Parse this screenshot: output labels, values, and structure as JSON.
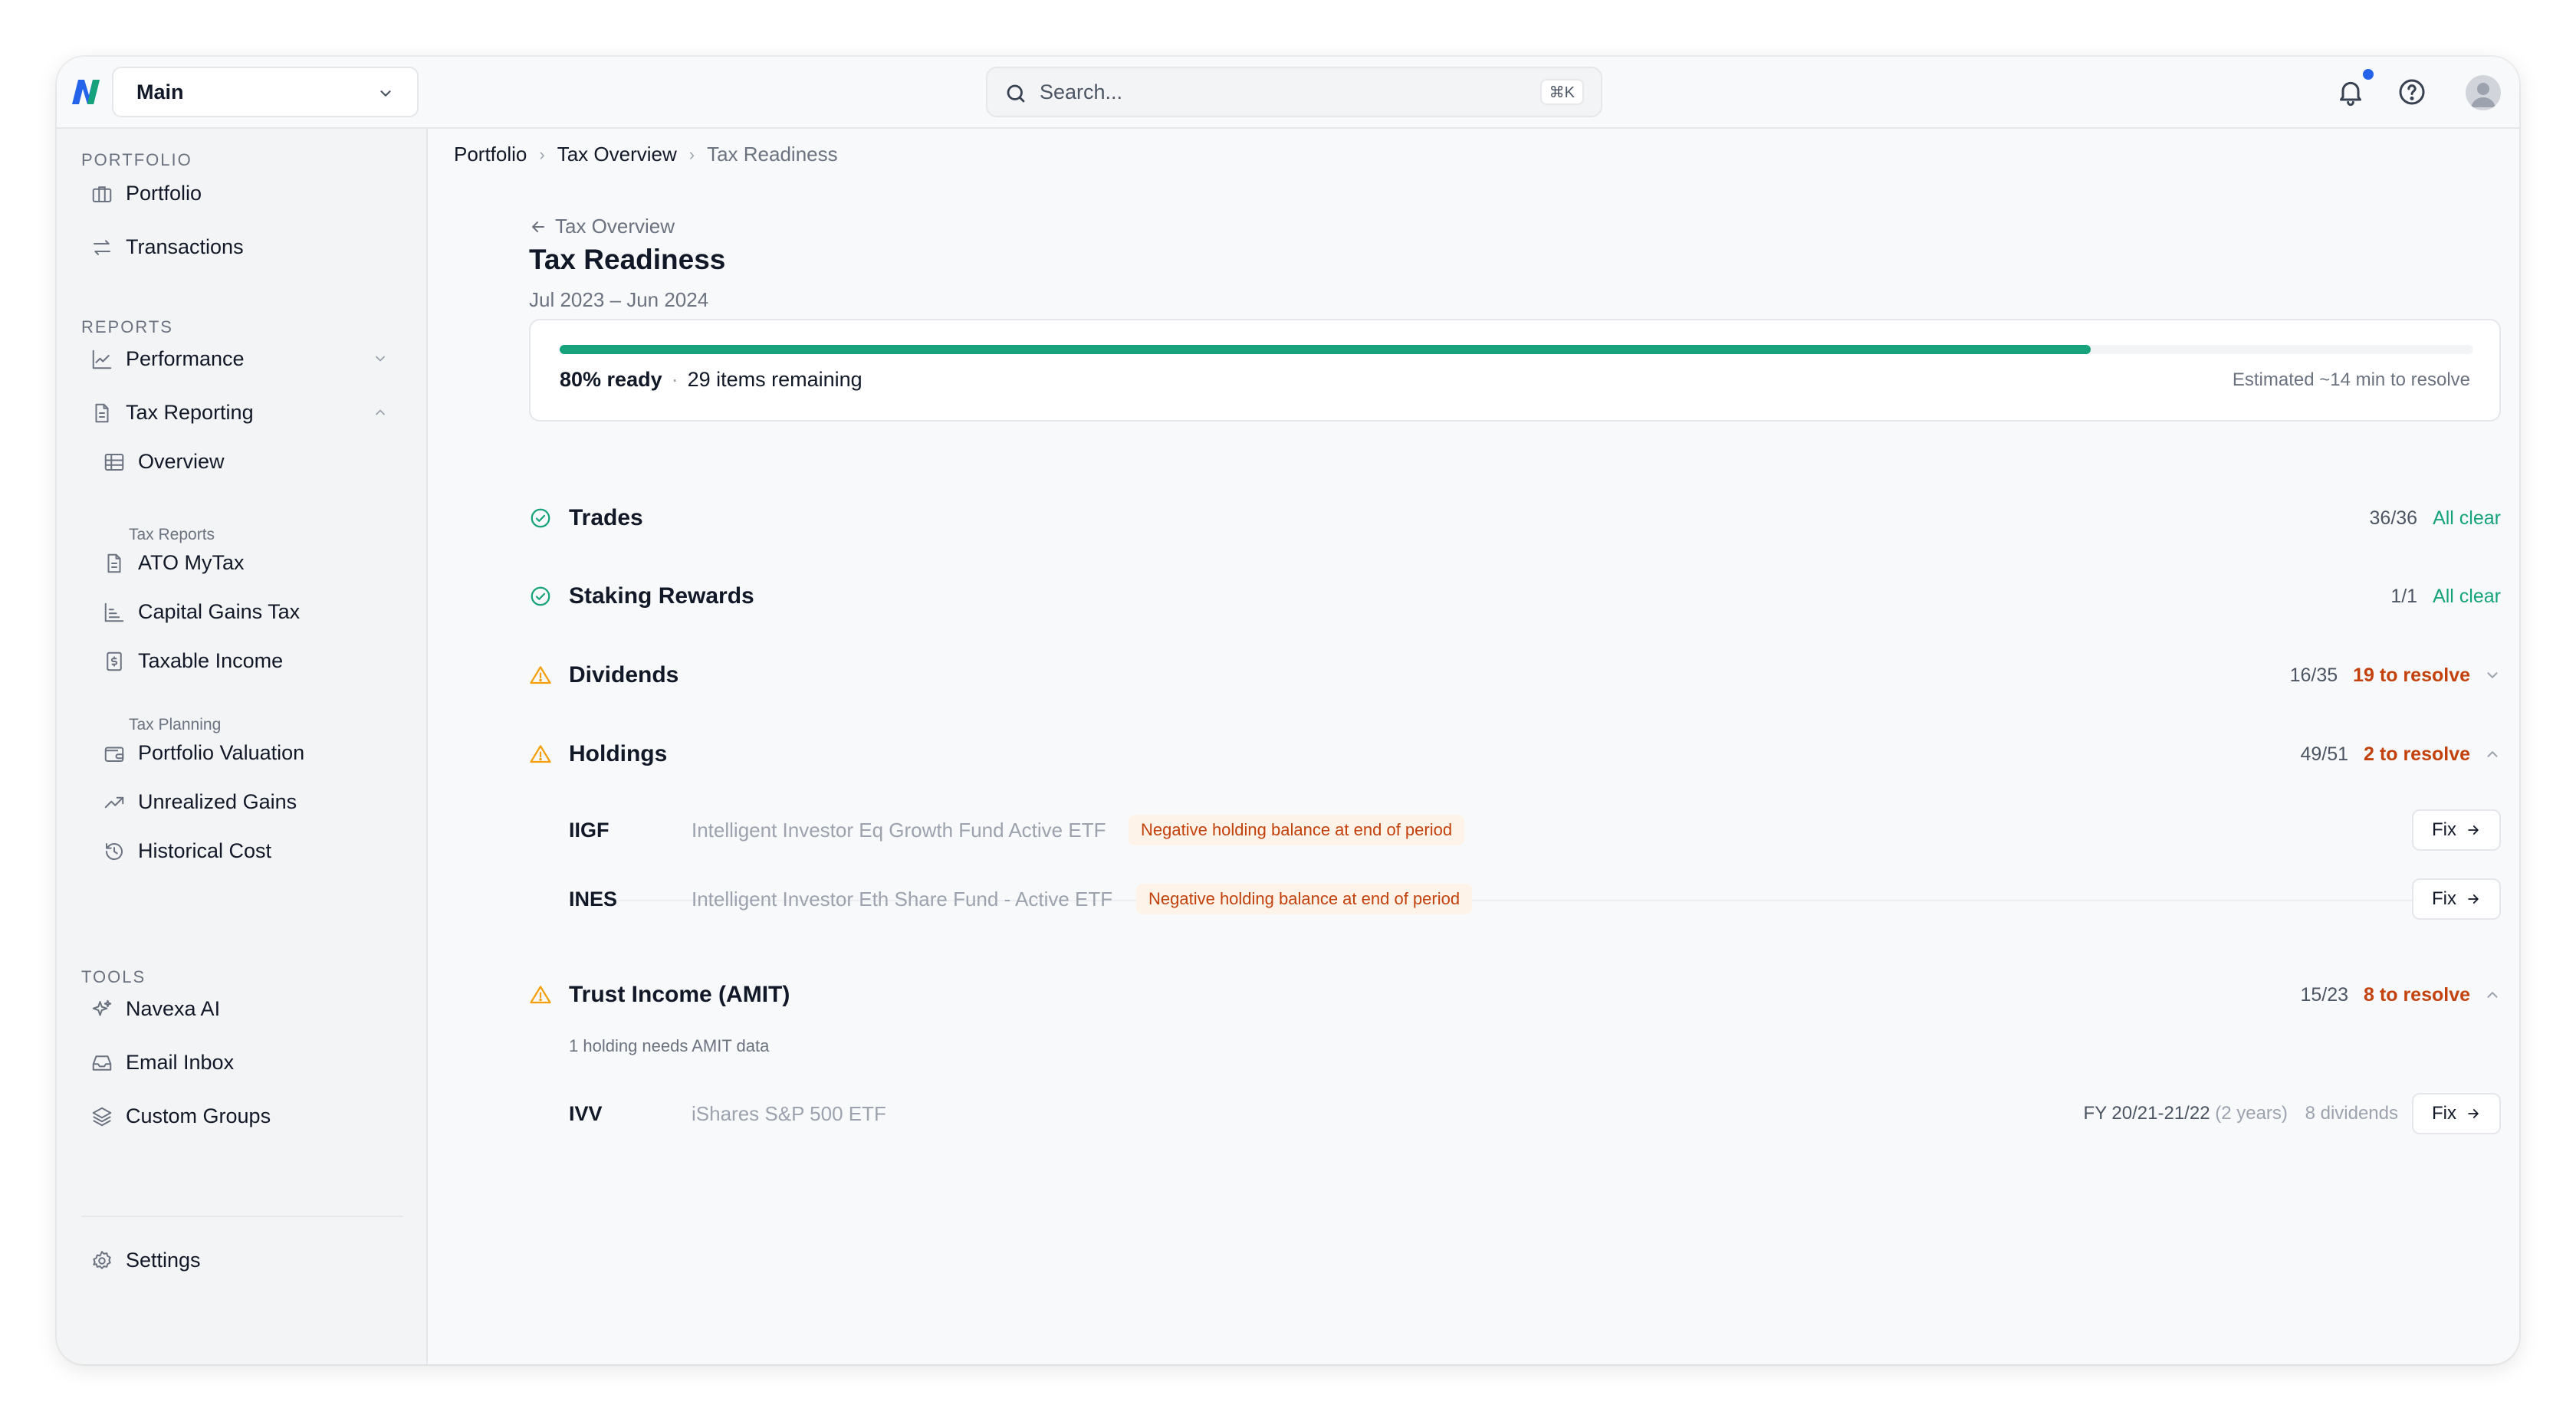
{
  "app": {
    "workspace": "Main",
    "search_placeholder": "Search...",
    "search_shortcut": "⌘K"
  },
  "sidebar": {
    "portfolio_label": "PORTFOLIO",
    "portfolio": "Portfolio",
    "transactions": "Transactions",
    "reports_label": "REPORTS",
    "performance": "Performance",
    "tax_reporting": "Tax Reporting",
    "overview": "Overview",
    "tax_reports_label": "Tax Reports",
    "ato_mytax": "ATO MyTax",
    "capital_gains_tax": "Capital Gains Tax",
    "taxable_income": "Taxable Income",
    "tax_planning_label": "Tax Planning",
    "portfolio_valuation": "Portfolio Valuation",
    "unrealized_gains": "Unrealized Gains",
    "historical_cost": "Historical Cost",
    "tools_label": "TOOLS",
    "navexa_ai": "Navexa AI",
    "email_inbox": "Email Inbox",
    "custom_groups": "Custom Groups",
    "settings": "Settings"
  },
  "breadcrumb": [
    "Portfolio",
    "Tax Overview",
    "Tax Readiness"
  ],
  "page": {
    "back_label": "Tax Overview",
    "title": "Tax Readiness",
    "date_range": "Jul 2023 – Jun 2024"
  },
  "progress": {
    "fraction": 0.8,
    "ready_label": "80% ready",
    "remaining_label": "29 items remaining",
    "estimate": "Estimated ~14 min to resolve"
  },
  "sections": {
    "trades": {
      "title": "Trades",
      "count": "36/36",
      "status": "All clear"
    },
    "staking": {
      "title": "Staking Rewards",
      "count": "1/1",
      "status": "All clear"
    },
    "dividends": {
      "title": "Dividends",
      "count": "16/35",
      "status": "19 to resolve"
    },
    "holdings": {
      "title": "Holdings",
      "count": "49/51",
      "status": "2 to resolve"
    },
    "trust": {
      "title": "Trust Income (AMIT)",
      "count": "15/23",
      "status": "8 to resolve",
      "note": "1 holding needs AMIT data"
    }
  },
  "holdings_items": [
    {
      "ticker": "IIGF",
      "name": "Intelligent Investor Eq Growth Fund Active ETF",
      "issue": "Negative holding balance at end of period",
      "action": "Fix"
    },
    {
      "ticker": "INES",
      "name": "Intelligent Investor Eth Share Fund - Active ETF",
      "issue": "Negative holding balance at end of period",
      "action": "Fix"
    }
  ],
  "trust_items": [
    {
      "ticker": "IVV",
      "name": "iShares S&P 500 ETF",
      "fy": "FY 20/21-21/22",
      "years": "(2 years)",
      "dividends": "8 dividends",
      "action": "Fix"
    }
  ],
  "colors": {
    "success": "#16a37b",
    "warning": "#f59e0b",
    "resolve": "#c2410c",
    "accent": "#2563eb"
  }
}
